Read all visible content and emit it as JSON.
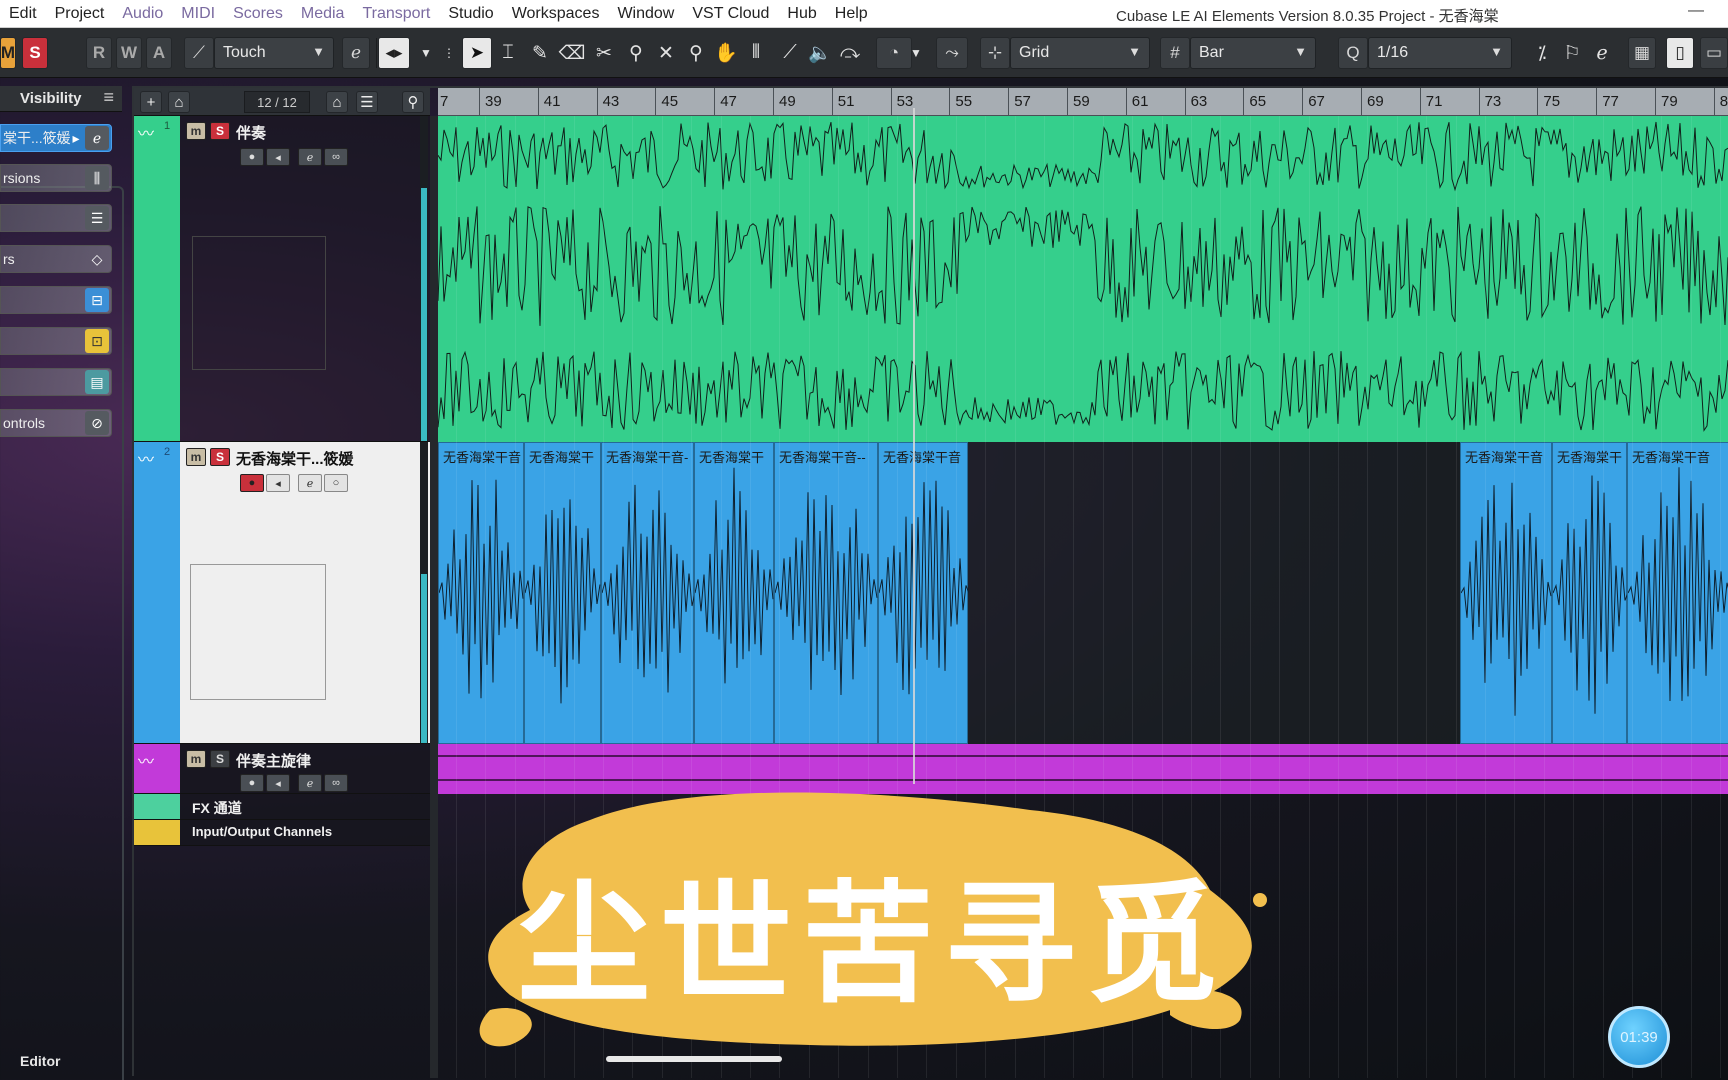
{
  "menubar": {
    "items": [
      "Edit",
      "Project",
      "Audio",
      "MIDI",
      "Scores",
      "Media",
      "Transport",
      "Studio",
      "Workspaces",
      "Window",
      "VST Cloud",
      "Hub",
      "Help"
    ],
    "window_title": "Cubase LE AI Elements Version 8.0.35 Project - 无香海棠",
    "minimize_glyph": "—"
  },
  "toolbar": {
    "m_label": "M",
    "s_label": "S",
    "r_label": "R",
    "w_label": "W",
    "a_label": "A",
    "automation_mode": "Touch",
    "snap_type": "Grid",
    "grid_type": "Bar",
    "quantize": "1/16"
  },
  "inspector": {
    "visibility_label": "Visibility",
    "rows": [
      {
        "label": "棠干...筱媛",
        "icon": "edit-icon"
      },
      {
        "label": "rsions",
        "icon": "versions-icon"
      },
      {
        "label": "",
        "icon": "mixer-icon"
      },
      {
        "label": "rs",
        "icon": "diamond-icon"
      },
      {
        "label": "",
        "icon": "fader-icon"
      },
      {
        "label": "",
        "icon": "notepad-icon"
      },
      {
        "label": "",
        "icon": "meter-icon"
      },
      {
        "label": "ontrols",
        "icon": "circle-slash-icon"
      }
    ],
    "editor_label": "Editor"
  },
  "project": {
    "track_count": "12 / 12",
    "ruler_labels": [
      "7",
      "39",
      "41",
      "43",
      "45",
      "47",
      "49",
      "51",
      "53",
      "55",
      "57",
      "59",
      "61",
      "63",
      "65",
      "67",
      "69",
      "71",
      "73",
      "75",
      "77",
      "79",
      "8"
    ],
    "tracks": [
      {
        "num": "1",
        "name": "伴奏",
        "color": "#35cf8c"
      },
      {
        "num": "2",
        "name": "无香海棠干...筱媛",
        "color": "#3aa3e6"
      },
      {
        "num": "",
        "name": "伴奏主旋律",
        "color": "#c23ad9"
      }
    ],
    "folders": [
      {
        "name": "FX 通道",
        "color": "#4dd09e"
      },
      {
        "name": "Input/Output Channels",
        "color": "#e8c33a"
      }
    ],
    "vocal_events": [
      "无香海棠干音",
      "无香海棠干",
      "无香海棠干音-",
      "无香海棠干",
      "无香海棠干音--",
      "无香海棠干音",
      "无香海棠干音",
      "无香海棠干",
      "无香海棠干音"
    ]
  },
  "overlay": {
    "subtitle": "尘世苦寻觅",
    "timer": "01:39"
  }
}
